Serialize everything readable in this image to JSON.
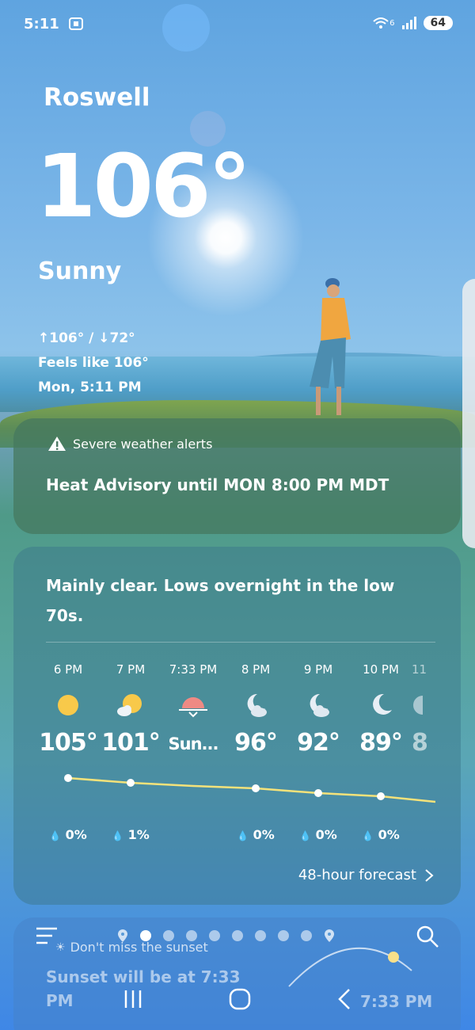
{
  "status_bar": {
    "time": "5:11",
    "wifi_label": "6",
    "battery": "64"
  },
  "current": {
    "city": "Roswell",
    "temperature": "106°",
    "condition": "Sunny",
    "high_low": "↑106° / ↓72°",
    "feels_like": "Feels like 106°",
    "date_time": "Mon, 5:11 PM"
  },
  "alert": {
    "title": "Severe weather alerts",
    "body": "Heat Advisory until MON 8:00 PM MDT"
  },
  "hourly": {
    "summary": "Mainly clear. Lows overnight in the low 70s.",
    "items": [
      {
        "time": "6 PM",
        "icon": "sun-icon",
        "temp": "105°",
        "precip": "0%"
      },
      {
        "time": "7 PM",
        "icon": "partly-sunny-icon",
        "temp": "101°",
        "precip": "1%"
      },
      {
        "time": "7:33 PM",
        "icon": "sunset-icon",
        "temp": "Sun...",
        "precip": ""
      },
      {
        "time": "8 PM",
        "icon": "partly-cloudy-night-icon",
        "temp": "96°",
        "precip": "0%"
      },
      {
        "time": "9 PM",
        "icon": "partly-cloudy-night-icon",
        "temp": "92°",
        "precip": "0%"
      },
      {
        "time": "10 PM",
        "icon": "clear-night-icon",
        "temp": "89°",
        "precip": "0%"
      },
      {
        "time": "11",
        "icon": "clear-night-icon",
        "temp": "8",
        "precip": ""
      }
    ],
    "link": "48-hour forecast"
  },
  "sunset": {
    "label": "Don't miss the sunset",
    "body": "Sunset will be at 7:33 PM",
    "time": "7:33 PM"
  },
  "colors": {
    "sun": "#f8c94a",
    "sunset": "#ef8a84",
    "line": "#f4e27a"
  }
}
